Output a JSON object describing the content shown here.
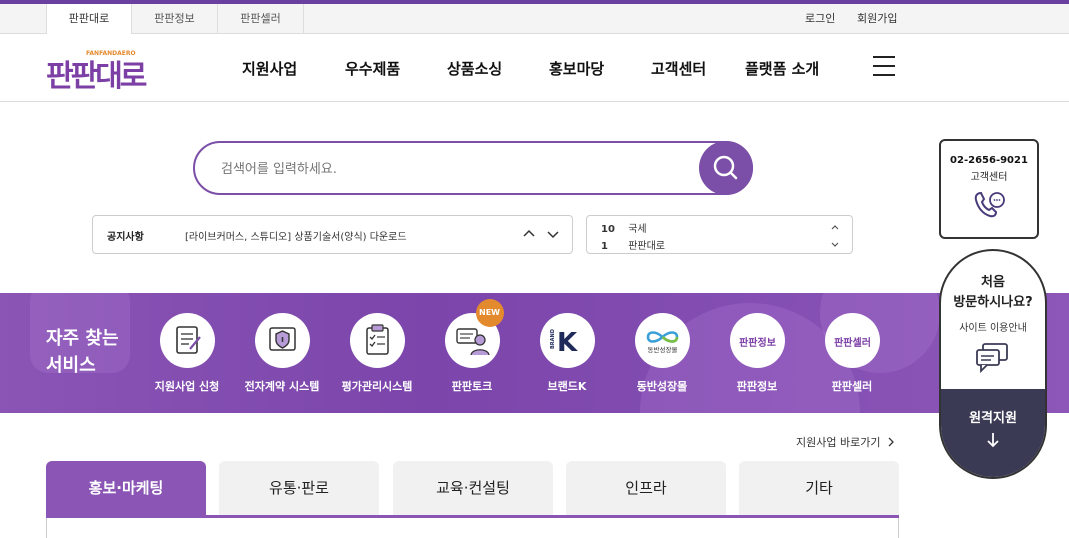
{
  "util": {
    "tabs": [
      "판판대로",
      "판판정보",
      "판판셀러"
    ],
    "login": "로그인",
    "signup": "회원가입"
  },
  "logo": {
    "text": "판판대로",
    "sub": "FANFANDAERO"
  },
  "nav": [
    "지원사업",
    "우수제품",
    "상품소싱",
    "홍보마당",
    "고객센터",
    "플랫폼 소개"
  ],
  "search": {
    "placeholder": "검색어를 입력하세요."
  },
  "notice": {
    "label": "공지사항",
    "text": "[라이브커머스, 스튜디오] 상품기술서(양식) 다운로드"
  },
  "ranking": {
    "items": [
      {
        "rank": "10",
        "text": "국세"
      },
      {
        "rank": "1",
        "text": "판판대로"
      }
    ]
  },
  "side": {
    "phone": "02-2656-9021",
    "center": "고객센터",
    "first_title_1": "처음",
    "first_title_2": "방문하시나요?",
    "first_sub": "사이트 이용안내",
    "remote": "원격지원"
  },
  "band": {
    "title": "자주 찾는 서비스",
    "services": [
      {
        "label": "지원사업 신청",
        "icon": "document-icon"
      },
      {
        "label": "전자계약 시스템",
        "icon": "shield-icon"
      },
      {
        "label": "평가관리시스템",
        "icon": "clipboard-icon"
      },
      {
        "label": "판판토크",
        "icon": "chat-person-icon",
        "badge": "NEW"
      },
      {
        "label": "브랜드K",
        "icon": "brand-k-icon",
        "icon_text": "K",
        "icon_side": "BRAND"
      },
      {
        "label": "동반성장몰",
        "icon": "infinity-icon",
        "icon_text": "동반성장몰"
      },
      {
        "label": "판판정보",
        "icon": "fanfan-info-icon",
        "icon_text": "판판정보"
      },
      {
        "label": "판판셀러",
        "icon": "fanfan-seller-icon",
        "icon_text": "판판셀러"
      }
    ]
  },
  "shortcut": "지원사업 바로가기",
  "tabs": [
    "홍보·마케팅",
    "유통·판로",
    "교육·컨설팅",
    "인프라",
    "기타"
  ],
  "colors": {
    "brand": "#7b4ea8",
    "accent": "#e48a2e",
    "remote_bg": "#3a3a55"
  }
}
